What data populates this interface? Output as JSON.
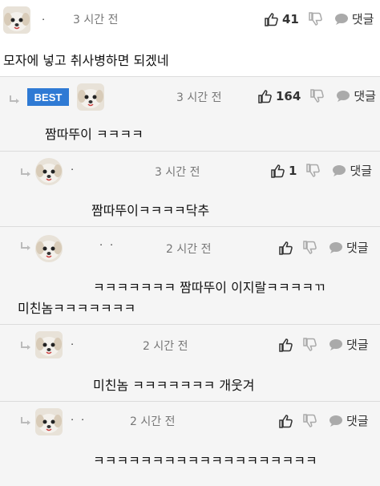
{
  "top_comment": {
    "name": "ㆍ",
    "time": "3 시간 전",
    "likes": "41",
    "reply_label": "댓글",
    "content": "모자에 넣고 취사병하면 되겠네"
  },
  "best": {
    "badge": "BEST",
    "name": "",
    "time": "3 시간 전",
    "likes": "164",
    "reply_label": "댓글",
    "content": "짬따뚜이 ㅋㅋㅋㅋ"
  },
  "replies": [
    {
      "name": "ㆍ",
      "time": "3 시간 전",
      "likes": "1",
      "reply_label": "댓글",
      "content": "짬따뚜이ㅋㅋㅋㅋ닥추"
    },
    {
      "name": "ㆍㆍ",
      "time": "2 시간 전",
      "likes": "",
      "reply_label": "댓글",
      "content_line1": "ㅋㅋㅋㅋㅋㅋㅋ 짬따뚜이 이지랄ㅋㅋㅋㅋㄲ",
      "content_line2": "미친놈ㅋㅋㅋㅋㅋㅋㅋ"
    },
    {
      "name": "ㆍ",
      "time": "2 시간 전",
      "likes": "",
      "reply_label": "댓글",
      "content": "미친놈 ㅋㅋㅋㅋㅋㅋㅋ 개웃겨"
    },
    {
      "name": "ㆍㆍ",
      "time": "2 시간 전",
      "likes": "",
      "reply_label": "댓글",
      "content": "ㅋㅋㅋㅋㅋㅋㅋㅋㅋㅋㅋㅋㅋㅋㅋㅋㅋㅋㅋ"
    }
  ],
  "icons": {
    "like": "thumbs-up-icon",
    "dislike": "thumbs-down-icon",
    "reply": "speech-bubble-icon",
    "reply_arrow": "reply-arrow-icon"
  },
  "colors": {
    "best_badge": "#2f7ad4",
    "reply_bg": "#f5f5f5"
  }
}
